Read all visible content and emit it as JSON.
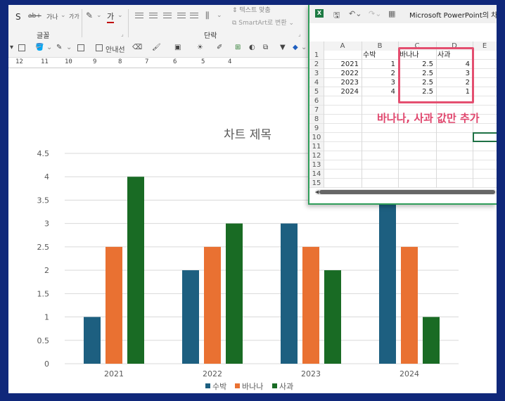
{
  "ribbon": {
    "font_group_label": "글꼴",
    "paragraph_group_label": "단락",
    "text_direction_label": "텍스트 맞춤",
    "smartart_label": "SmartArt로 변환",
    "font_s_label": "S",
    "char_spacing_label": "가나",
    "font_size_label": "가가",
    "font_color_label": "가"
  },
  "toolbar": {
    "gridlines_label": "안내선"
  },
  "ruler": {
    "ticks": [
      "12",
      "11",
      "10",
      "9",
      "8",
      "7",
      "6",
      "5",
      "4"
    ]
  },
  "excel": {
    "title": "Microsoft PowerPoint의 차트",
    "columns": [
      "A",
      "B",
      "C",
      "D",
      "E"
    ],
    "rows": [
      "1",
      "2",
      "3",
      "4",
      "5",
      "6",
      "7",
      "8",
      "9",
      "10",
      "11",
      "12",
      "13",
      "14",
      "15"
    ],
    "header": {
      "b": "수박",
      "c": "바나나",
      "d": "사과"
    },
    "data": [
      {
        "a": "2021",
        "b": "1",
        "c": "2.5",
        "d": "4"
      },
      {
        "a": "2022",
        "b": "2",
        "c": "2.5",
        "d": "3"
      },
      {
        "a": "2023",
        "b": "3",
        "c": "2.5",
        "d": "2"
      },
      {
        "a": "2024",
        "b": "4",
        "c": "2.5",
        "d": "1"
      }
    ],
    "annotation": "바나나, 사과 값만 추가"
  },
  "chart_data": {
    "type": "bar",
    "title": "차트 제목",
    "categories": [
      "2021",
      "2022",
      "2023",
      "2024"
    ],
    "series": [
      {
        "name": "수박",
        "values": [
          1,
          2,
          3,
          4
        ],
        "color": "#1d5f80"
      },
      {
        "name": "바나나",
        "values": [
          2.5,
          2.5,
          2.5,
          2.5
        ],
        "color": "#e97132"
      },
      {
        "name": "사과",
        "values": [
          4,
          3,
          2,
          1
        ],
        "color": "#196b24"
      }
    ],
    "ylim": [
      0,
      4.5
    ],
    "yticks": [
      "0",
      "0.5",
      "1",
      "1.5",
      "2",
      "2.5",
      "3",
      "3.5",
      "4",
      "4.5"
    ],
    "grid": true,
    "legend": "bottom"
  }
}
